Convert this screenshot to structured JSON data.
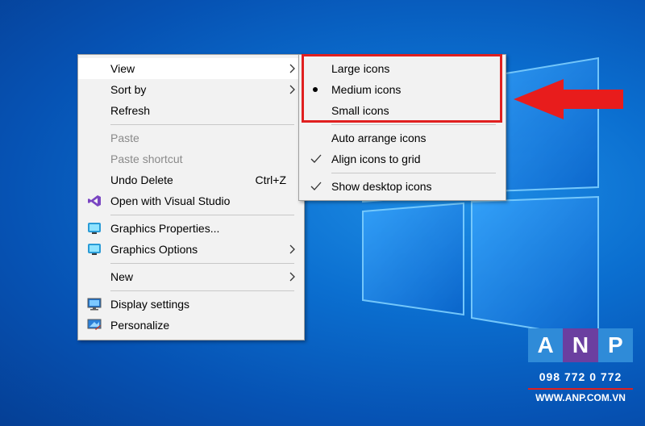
{
  "main_menu": {
    "view": "View",
    "sort_by": "Sort by",
    "refresh": "Refresh",
    "paste": "Paste",
    "paste_shortcut": "Paste shortcut",
    "undo_delete": "Undo Delete",
    "undo_delete_shortcut": "Ctrl+Z",
    "open_visual_studio": "Open with Visual Studio",
    "graphics_properties": "Graphics Properties...",
    "graphics_options": "Graphics Options",
    "new": "New",
    "display_settings": "Display settings",
    "personalize": "Personalize"
  },
  "view_submenu": {
    "large_icons": "Large icons",
    "medium_icons": "Medium icons",
    "small_icons": "Small icons",
    "auto_arrange": "Auto arrange icons",
    "align_to_grid": "Align icons to grid",
    "show_desktop_icons": "Show desktop icons",
    "selected_size": "Medium icons"
  },
  "watermark": {
    "letters": [
      "A",
      "N",
      "P"
    ],
    "phone": "098 772 0 772",
    "website": "WWW.ANP.COM.VN"
  },
  "colors": {
    "highlight": "#e02020",
    "desktop_blue": "#0b6fd0",
    "menu_bg": "#f2f2f2"
  }
}
